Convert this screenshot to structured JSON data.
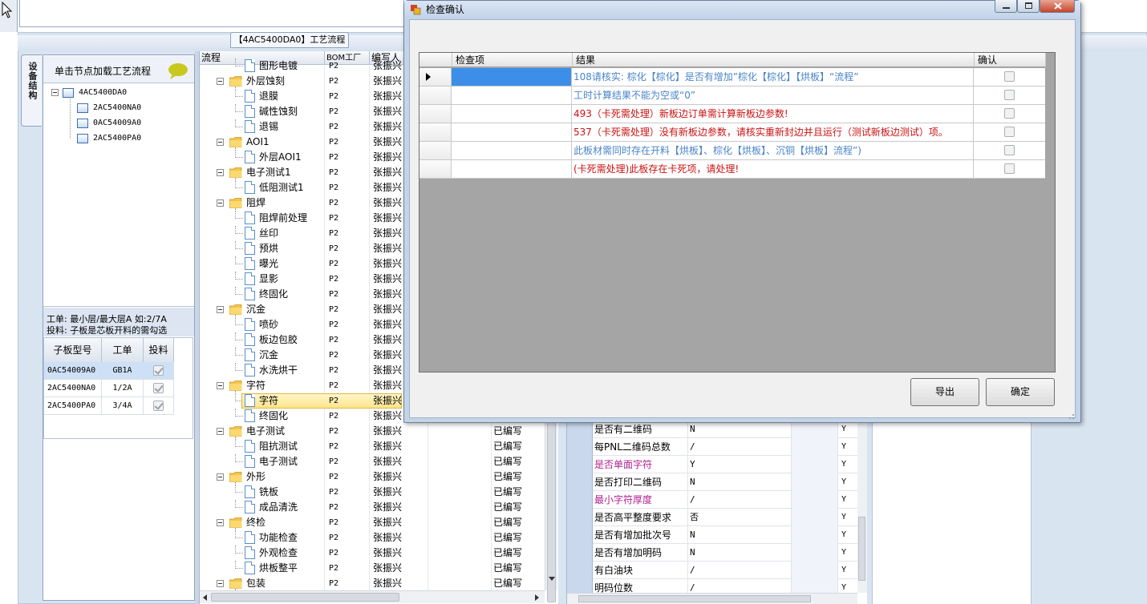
{
  "main_window": {
    "process_tab_label": "【4AC5400DA0】工艺流程",
    "side_tab_label": "设备结构",
    "left_panel": {
      "load_hint": "单击节点加载工艺流程",
      "tree": [
        {
          "label": "4AC5400DA0",
          "level": 0
        },
        {
          "label": "2AC5400NA0",
          "level": 1
        },
        {
          "label": "0AC54009A0",
          "level": 1
        },
        {
          "label": "2AC5400PA0",
          "level": 1
        }
      ],
      "info_line1": "工单: 最小层/最大层A 如:2/7A",
      "info_line2": "投料: 子板是芯板开料的需勾选",
      "sub_table": {
        "headers": [
          "子板型号",
          "工单",
          "投料"
        ],
        "rows": [
          {
            "model": "0AC54009A0",
            "order": "GB1A",
            "feed": true
          },
          {
            "model": "2AC5400NA0",
            "order": "1/2A",
            "feed": true
          },
          {
            "model": "2AC5400PA0",
            "order": "3/4A",
            "feed": true
          }
        ]
      }
    },
    "process_grid": {
      "headers": [
        "流程",
        "BOM工厂",
        "编写人"
      ],
      "rows": [
        {
          "name": "图形电镀",
          "type": "doc",
          "level": 1,
          "bom": "P2",
          "writer": "张振兴",
          "status": ""
        },
        {
          "name": "外层蚀刻",
          "type": "folder",
          "level": 0,
          "bom": "P2",
          "writer": "张振兴",
          "status": ""
        },
        {
          "name": "退膜",
          "type": "doc",
          "level": 1,
          "bom": "P2",
          "writer": "张振兴",
          "status": ""
        },
        {
          "name": "碱性蚀刻",
          "type": "doc",
          "level": 1,
          "bom": "P2",
          "writer": "张振兴",
          "status": ""
        },
        {
          "name": "退锡",
          "type": "doc",
          "level": 1,
          "bom": "P2",
          "writer": "张振兴",
          "status": ""
        },
        {
          "name": "AOI1",
          "type": "folder",
          "level": 0,
          "bom": "P2",
          "writer": "张振兴",
          "status": ""
        },
        {
          "name": "外层AOI1",
          "type": "doc",
          "level": 1,
          "bom": "P2",
          "writer": "张振兴",
          "status": ""
        },
        {
          "name": "电子测试1",
          "type": "folder",
          "level": 0,
          "bom": "P2",
          "writer": "张振兴",
          "status": ""
        },
        {
          "name": "低阻测试1",
          "type": "doc",
          "level": 1,
          "bom": "P2",
          "writer": "张振兴",
          "status": ""
        },
        {
          "name": "阻焊",
          "type": "folder",
          "level": 0,
          "bom": "P2",
          "writer": "张振兴",
          "status": ""
        },
        {
          "name": "阻焊前处理",
          "type": "doc",
          "level": 1,
          "bom": "P2",
          "writer": "张振兴",
          "status": ""
        },
        {
          "name": "丝印",
          "type": "doc",
          "level": 1,
          "bom": "P2",
          "writer": "张振兴",
          "status": ""
        },
        {
          "name": "预烘",
          "type": "doc",
          "level": 1,
          "bom": "P2",
          "writer": "张振兴",
          "status": ""
        },
        {
          "name": "曝光",
          "type": "doc",
          "level": 1,
          "bom": "P2",
          "writer": "张振兴",
          "status": ""
        },
        {
          "name": "显影",
          "type": "doc",
          "level": 1,
          "bom": "P2",
          "writer": "张振兴",
          "status": ""
        },
        {
          "name": "终固化",
          "type": "doc",
          "level": 1,
          "bom": "P2",
          "writer": "张振兴",
          "status": ""
        },
        {
          "name": "沉金",
          "type": "folder",
          "level": 0,
          "bom": "P2",
          "writer": "张振兴",
          "status": ""
        },
        {
          "name": "喷砂",
          "type": "doc",
          "level": 1,
          "bom": "P2",
          "writer": "张振兴",
          "status": ""
        },
        {
          "name": "板边包胶",
          "type": "doc",
          "level": 1,
          "bom": "P2",
          "writer": "张振兴",
          "status": ""
        },
        {
          "name": "沉金",
          "type": "doc",
          "level": 1,
          "bom": "P2",
          "writer": "张振兴",
          "status": ""
        },
        {
          "name": "水洗烘干",
          "type": "doc",
          "level": 1,
          "bom": "P2",
          "writer": "张振兴",
          "status": ""
        },
        {
          "name": "字符",
          "type": "folder",
          "level": 0,
          "bom": "P2",
          "writer": "张振兴",
          "status": ""
        },
        {
          "name": "字符",
          "type": "doc",
          "level": 1,
          "bom": "P2",
          "writer": "张振兴",
          "status": "",
          "selected": true
        },
        {
          "name": "终固化",
          "type": "doc",
          "level": 1,
          "bom": "P2",
          "writer": "张振兴",
          "status": ""
        },
        {
          "name": "电子测试",
          "type": "folder",
          "level": 0,
          "bom": "P2",
          "writer": "张振兴",
          "status": "已编写"
        },
        {
          "name": "阻抗测试",
          "type": "doc",
          "level": 1,
          "bom": "P2",
          "writer": "张振兴",
          "status": "已编写"
        },
        {
          "name": "电子测试",
          "type": "doc",
          "level": 1,
          "bom": "P2",
          "writer": "张振兴",
          "status": "已编写"
        },
        {
          "name": "外形",
          "type": "folder",
          "level": 0,
          "bom": "P2",
          "writer": "张振兴",
          "status": "已编写"
        },
        {
          "name": "铣板",
          "type": "doc",
          "level": 1,
          "bom": "P2",
          "writer": "张振兴",
          "status": "已编写"
        },
        {
          "name": "成品清洗",
          "type": "doc",
          "level": 1,
          "bom": "P2",
          "writer": "张振兴",
          "status": "已编写"
        },
        {
          "name": "终检",
          "type": "folder",
          "level": 0,
          "bom": "P2",
          "writer": "张振兴",
          "status": "已编写"
        },
        {
          "name": "功能检查",
          "type": "doc",
          "level": 1,
          "bom": "P2",
          "writer": "张振兴",
          "status": "已编写"
        },
        {
          "name": "外观检查",
          "type": "doc",
          "level": 1,
          "bom": "P2",
          "writer": "张振兴",
          "status": "已编写"
        },
        {
          "name": "烘板整平",
          "type": "doc",
          "level": 1,
          "bom": "P2",
          "writer": "张振兴",
          "status": "已编写"
        },
        {
          "name": "包装",
          "type": "folder",
          "level": 0,
          "bom": "P2",
          "writer": "张振兴",
          "status": "已编写"
        }
      ]
    },
    "param_grid": {
      "rows": [
        {
          "key": "是否有二维码",
          "value": "N",
          "flag": "Y",
          "color": "#000000"
        },
        {
          "key": "每PNL二维码总数",
          "value": "/",
          "flag": "Y",
          "color": "#000000"
        },
        {
          "key": "是否单面字符",
          "value": "Y",
          "flag": "Y",
          "color": "#b0208f"
        },
        {
          "key": "是否打印二维码",
          "value": "N",
          "flag": "Y",
          "color": "#000000"
        },
        {
          "key": "最小字符厚度",
          "value": "/",
          "flag": "Y",
          "color": "#b0208f"
        },
        {
          "key": "是否高平整度要求",
          "value": "否",
          "flag": "Y",
          "color": "#000000"
        },
        {
          "key": "是否有增加批次号",
          "value": "N",
          "flag": "Y",
          "color": "#000000"
        },
        {
          "key": "是否有增加明码",
          "value": "N",
          "flag": "Y",
          "color": "#000000"
        },
        {
          "key": "有白油块",
          "value": "/",
          "flag": "Y",
          "color": "#000000"
        },
        {
          "key": "明码位数",
          "value": "/",
          "flag": "Y",
          "color": "#000000"
        }
      ]
    }
  },
  "dialog": {
    "title": "检查确认",
    "headers": [
      "检查项",
      "结果",
      "确认"
    ],
    "rows": [
      {
        "item": "",
        "result": "108请核实: 棕化【棕化】是否有增加”棕化【棕化】【烘板】“流程”",
        "color": "blue",
        "checked": false,
        "current": true
      },
      {
        "item": "",
        "result": "工时计算结果不能为空或“0”",
        "color": "blue",
        "checked": false
      },
      {
        "item": "",
        "result": "493（卡死需处理）新板边订单需计算新板边参数!",
        "color": "red",
        "checked": false
      },
      {
        "item": "",
        "result": "537（卡死需处理）没有新板边参数，请核实重新封边并且运行（测试新板边测试）项。",
        "color": "red",
        "checked": false
      },
      {
        "item": "",
        "result": "此板材需同时存在开料【烘板】、棕化【烘板】、沉铜【烘板】流程”)",
        "color": "blue",
        "checked": false
      },
      {
        "item": "",
        "result": "(卡死需处理)此板存在卡死项，请处理!",
        "color": "red",
        "checked": false
      }
    ],
    "export_label": "导出",
    "ok_label": "确定"
  },
  "colors": {
    "info_blue": "#4a84c9",
    "error_red": "#cc1111",
    "selection_yellow": "#ffe58c",
    "frame_blue": "#d9e4f1"
  },
  "icons": [
    "cursor-arrow-icon",
    "speech-bubble-icon",
    "folder-icon",
    "document-icon",
    "dialog-app-icon",
    "minimize-icon",
    "maximize-icon",
    "close-icon"
  ]
}
